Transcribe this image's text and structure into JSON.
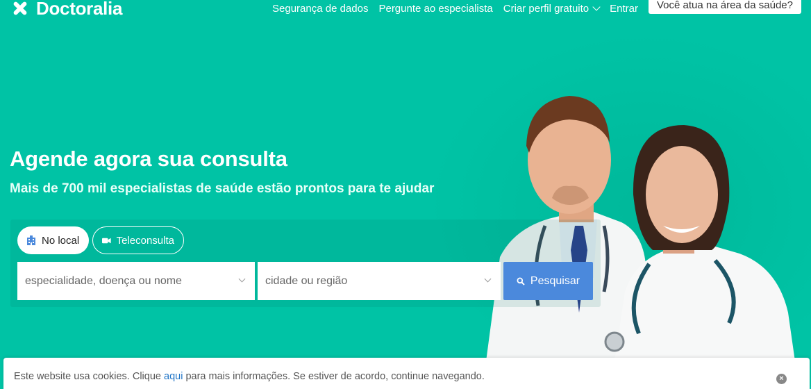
{
  "header": {
    "logo_text": "Doctoralia",
    "nav": {
      "security": "Segurança de dados",
      "ask_specialist": "Pergunte ao especialista",
      "create_profile": "Criar perfil gratuito",
      "login": "Entrar",
      "pro_cta": "Você atua na área da saúde?"
    }
  },
  "hero": {
    "title": "Agende agora sua consulta",
    "subtitle": "Mais de 700 mil especialistas de saúde estão prontos para te ajudar"
  },
  "search": {
    "tabs": [
      {
        "label": "No local",
        "icon": "building-icon",
        "active": true
      },
      {
        "label": "Teleconsulta",
        "icon": "video-camera-icon",
        "active": false
      }
    ],
    "specialty_placeholder": "especialidade, doença ou nome",
    "location_placeholder": "cidade ou região",
    "button_label": "Pesquisar"
  },
  "cookie": {
    "text_before": "Este website usa cookies. Clique ",
    "link": "aqui",
    "text_after": " para mais informações. Se estiver de acordo, continue navegando.",
    "close_icon": "close-icon"
  },
  "colors": {
    "brand": "#00c3a5",
    "search_button": "#4b89dc",
    "link": "#2276c7"
  }
}
